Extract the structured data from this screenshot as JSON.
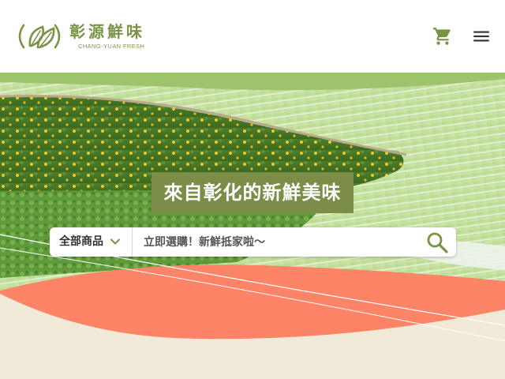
{
  "brand": {
    "name_zh": "彰源鮮味",
    "name_en": "CHANG-YUAN FRESH",
    "logo_icon": "leaf-logo-icon",
    "color": "#7a9446"
  },
  "header": {
    "cart_icon": "shopping-cart-icon",
    "menu_icon": "hamburger-menu-icon"
  },
  "hero": {
    "title": "來自彰化的新鮮美味",
    "title_bg": "#7c8d48",
    "wave_color": "#fd8466",
    "base_color": "#f2ead8"
  },
  "search": {
    "category_label": "全部商品",
    "category_icon": "chevron-down-icon",
    "placeholder": "立即選購！新鮮抵家啦～",
    "value": "",
    "button_icon": "search-icon"
  }
}
